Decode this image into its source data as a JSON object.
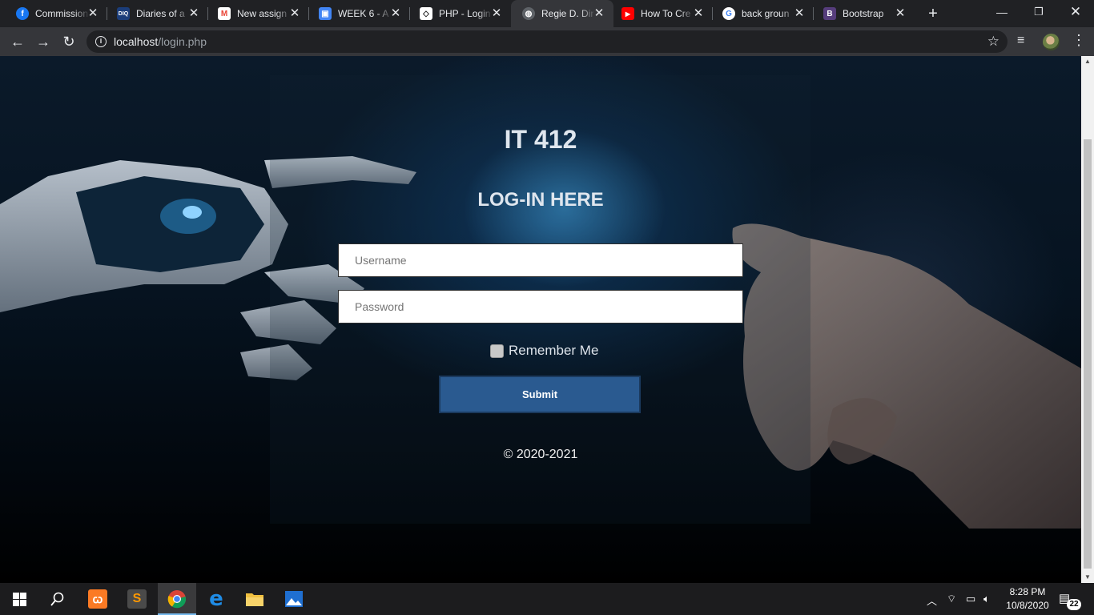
{
  "browser": {
    "tabs": [
      {
        "title": "Commission",
        "icon": "facebook-icon",
        "color": "#1877f2",
        "glyph": "f"
      },
      {
        "title": "Diaries of a",
        "icon": "diq-icon",
        "color": "#1b3d7a",
        "glyph": "DIQ"
      },
      {
        "title": "New assign",
        "icon": "gmail-icon",
        "color": "#ea4335",
        "glyph": "M"
      },
      {
        "title": "WEEK 6 - A",
        "icon": "classroom-icon",
        "color": "#1e8e3e",
        "glyph": "▣"
      },
      {
        "title": "PHP - Login",
        "icon": "codepen-icon",
        "color": "#555555",
        "glyph": "◇"
      },
      {
        "title": "Regie D. Dir",
        "icon": "globe-icon",
        "color": "#6f6f6f",
        "glyph": "◍"
      },
      {
        "title": "How To Cre",
        "icon": "youtube-icon",
        "color": "#ff0000",
        "glyph": "▶"
      },
      {
        "title": "back groun",
        "icon": "google-icon",
        "color": "#ffffff",
        "glyph": "G"
      },
      {
        "title": "Bootstrap",
        "icon": "bootstrap-icon",
        "color": "#563d7c",
        "glyph": "B"
      }
    ],
    "active_tab_index": 5,
    "url_host": "localhost",
    "url_path": "/login.php"
  },
  "page": {
    "heading": "IT 412",
    "subheading": "LOG-IN HERE",
    "username_placeholder": "Username",
    "password_placeholder": "Password",
    "remember_label": "Remember Me",
    "submit_label": "Submit",
    "footer": "© 2020-2021"
  },
  "taskbar": {
    "apps": [
      "windows-start-icon",
      "search-icon",
      "xampp-icon",
      "sublime-text-icon",
      "chrome-icon",
      "edge-icon",
      "file-explorer-icon",
      "photos-icon"
    ],
    "time": "8:28 PM",
    "date": "10/8/2020",
    "notification_count": "22"
  }
}
